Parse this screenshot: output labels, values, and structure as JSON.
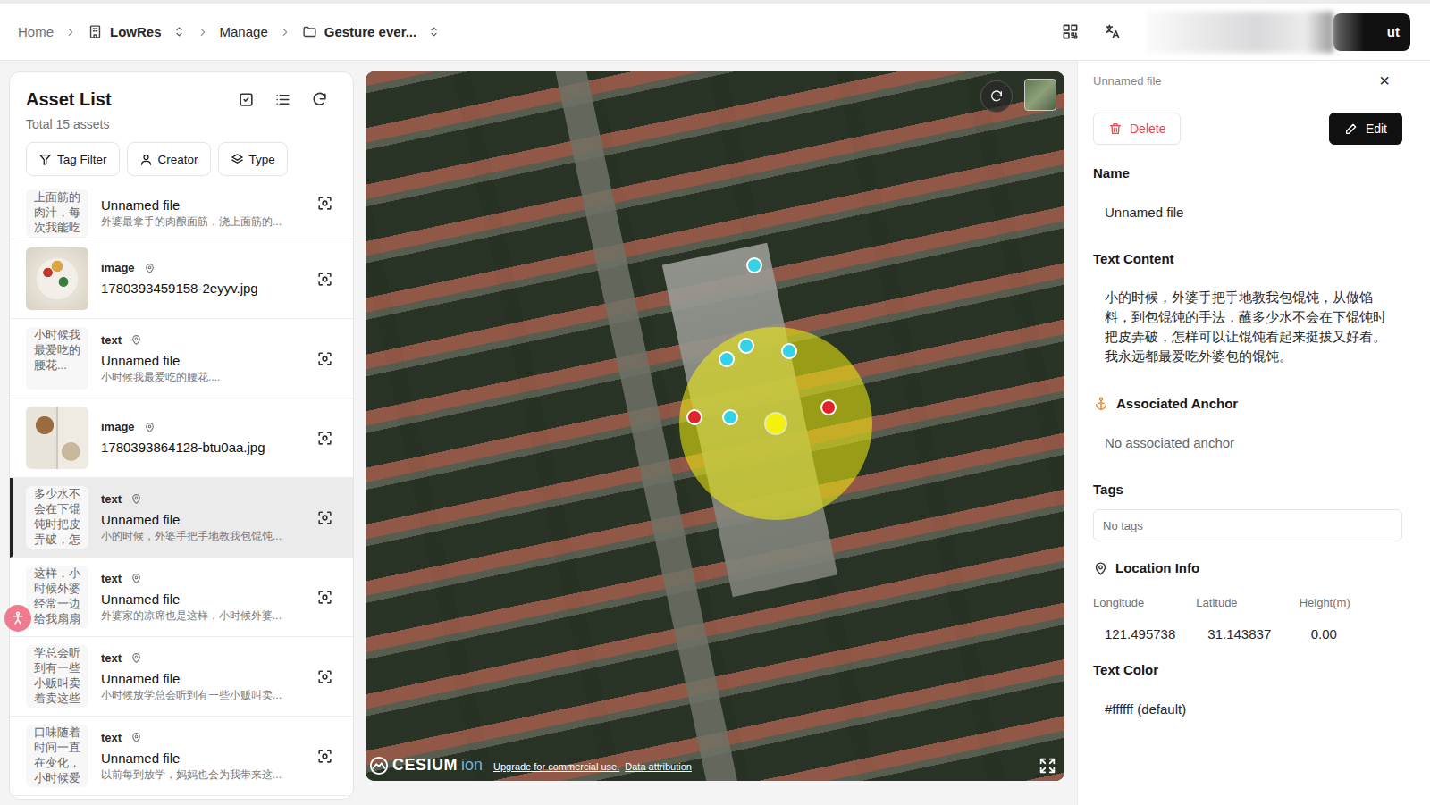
{
  "breadcrumb": [
    {
      "label": "Home",
      "kind": "link"
    },
    {
      "label": "LowRes",
      "kind": "switch"
    },
    {
      "label": "Manage",
      "kind": "link"
    },
    {
      "label": "Gesture ever...",
      "kind": "switch"
    }
  ],
  "account": {
    "button": "ut"
  },
  "asset_list": {
    "title": "Asset List",
    "total": "Total 15 assets",
    "filters": [
      "Tag Filter",
      "Creator",
      "Type"
    ],
    "items": [
      {
        "kind": "text",
        "badge": null,
        "thumb_text": "上面筋的肉汁，每次我能吃",
        "name": "Unnamed file",
        "preview": "外婆最拿手的肉酿面筋，浇上面筋的...",
        "selected": false
      },
      {
        "kind": "image",
        "badge": "image",
        "thumb_text": null,
        "name": "1780393459158-2eyyv.jpg",
        "preview": null,
        "selected": false
      },
      {
        "kind": "text",
        "badge": "text",
        "thumb_text": "小时候我最爱吃的腰花...",
        "name": "Unnamed file",
        "preview": "小时候我最爱吃的腰花....",
        "selected": false
      },
      {
        "kind": "image",
        "badge": "image",
        "thumb_text": null,
        "name": "1780393864128-btu0aa.jpg",
        "preview": null,
        "selected": false
      },
      {
        "kind": "text",
        "badge": "text",
        "thumb_text": "多少水不会在下馄饨时把皮弄破，怎",
        "name": "Unnamed file",
        "preview": "小的时候，外婆手把手地教我包馄饨...",
        "selected": true
      },
      {
        "kind": "text",
        "badge": "text",
        "thumb_text": "这样，小时候外婆经常一边给我扇扇",
        "name": "Unnamed file",
        "preview": "外婆家的凉席也是这样，小时候外婆...",
        "selected": false
      },
      {
        "kind": "text",
        "badge": "text",
        "thumb_text": "学总会听到有一些小贩叫卖着卖这些",
        "name": "Unnamed file",
        "preview": "小时候放学总会听到有一些小贩叫卖...",
        "selected": false
      },
      {
        "kind": "text",
        "badge": "text",
        "thumb_text": "口味随着时间一直在变化，小时候爱",
        "name": "Unnamed file",
        "preview": "以前每到放学，妈妈也会为我带来这...",
        "selected": false
      }
    ]
  },
  "map": {
    "markers": [
      {
        "kind": "range",
        "color": "#f4f20c"
      },
      {
        "kind": "center",
        "color": "#f4f20c"
      },
      {
        "kind": "asset",
        "color": "#34d2e4"
      },
      {
        "kind": "asset",
        "color": "#34d2e4"
      },
      {
        "kind": "asset",
        "color": "#34d2e4"
      },
      {
        "kind": "asset",
        "color": "#34d2e4"
      },
      {
        "kind": "asset",
        "color": "#34d2e4"
      },
      {
        "kind": "asset",
        "color": "#e0242b"
      },
      {
        "kind": "asset",
        "color": "#e0242b"
      }
    ],
    "logo": {
      "brand": "CESIUM",
      "product": "ion"
    },
    "links": [
      "Upgrade for commercial use.",
      "Data attribution"
    ]
  },
  "detail": {
    "header": "Unnamed file",
    "close": "×",
    "actions": {
      "delete": "Delete",
      "edit": "Edit"
    },
    "name": {
      "label": "Name",
      "value": "Unnamed file"
    },
    "text_content": {
      "label": "Text Content",
      "value": "小的时候，外婆手把手地教我包馄饨，从做馅料，到包馄饨的手法，蘸多少水不会在下馄饨时把皮弄破，怎样可以让馄饨看起来挺拔又好看。我永远都最爱吃外婆包的馄饨。"
    },
    "anchor": {
      "label": "Associated Anchor",
      "value": "No associated anchor"
    },
    "tags": {
      "label": "Tags",
      "placeholder": "No tags"
    },
    "location": {
      "label": "Location Info",
      "fields": [
        {
          "label": "Longitude",
          "value": "121.495738"
        },
        {
          "label": "Latitude",
          "value": "31.143837"
        },
        {
          "label": "Height(m)",
          "value": "0.00"
        }
      ]
    },
    "text_color": {
      "label": "Text Color",
      "value": "#ffffff (default)"
    }
  }
}
